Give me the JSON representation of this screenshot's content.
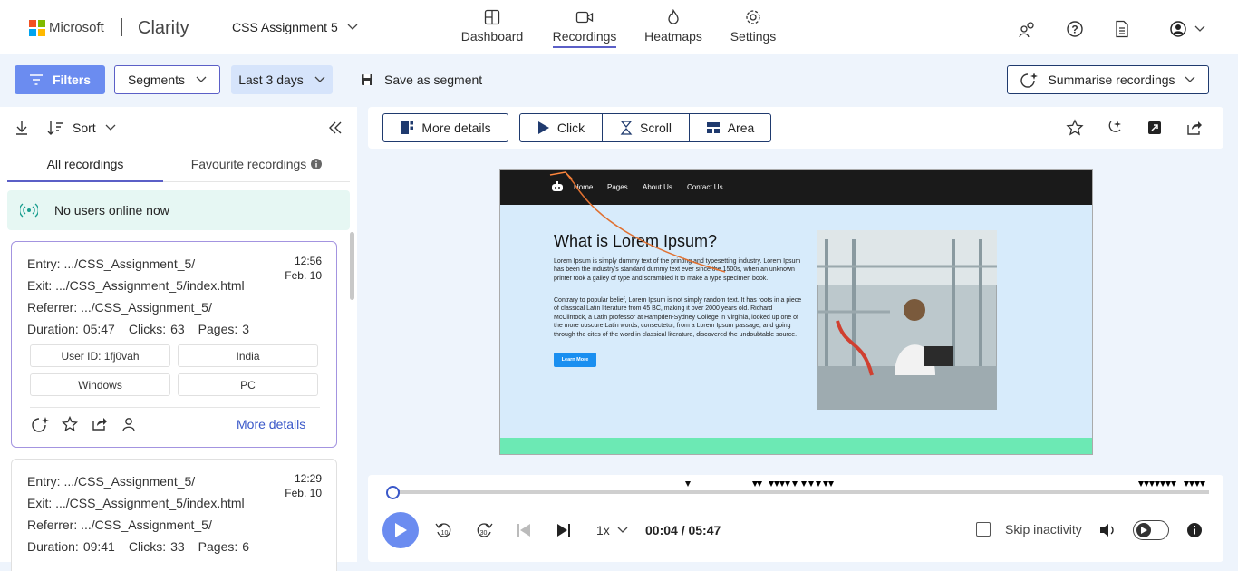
{
  "app": {
    "brand": "Microsoft",
    "product": "Clarity",
    "project": "CSS Assignment 5"
  },
  "nav": [
    {
      "label": "Dashboard",
      "icon": "dashboard-icon"
    },
    {
      "label": "Recordings",
      "icon": "video-icon",
      "active": true
    },
    {
      "label": "Heatmaps",
      "icon": "flame-icon"
    },
    {
      "label": "Settings",
      "icon": "gear-icon"
    }
  ],
  "toolbar": {
    "filters_label": "Filters",
    "segments_label": "Segments",
    "daterange_label": "Last 3 days",
    "save_segment_label": "Save as segment",
    "summarise_label": "Summarise recordings"
  },
  "left": {
    "sort_label": "Sort",
    "tabs": [
      "All recordings",
      "Favourite recordings"
    ],
    "online_text": "No users online now",
    "recordings": [
      {
        "entry": "Entry: .../CSS_Assignment_5/",
        "exit": "Exit: .../CSS_Assignment_5/index.html",
        "referrer": "Referrer: .../CSS_Assignment_5/",
        "duration_label": "Duration:",
        "duration": "05:47",
        "clicks_label": "Clicks:",
        "clicks": "63",
        "pages_label": "Pages:",
        "pages": "3",
        "time": "12:56",
        "date": "Feb. 10",
        "chips": [
          "User ID: 1fj0vah",
          "India",
          "Windows",
          "PC"
        ],
        "more_details": "More details"
      },
      {
        "entry": "Entry: .../CSS_Assignment_5/",
        "exit": "Exit: .../CSS_Assignment_5/index.html",
        "referrer": "Referrer: .../CSS_Assignment_5/",
        "duration_label": "Duration:",
        "duration": "09:41",
        "clicks_label": "Clicks:",
        "clicks": "33",
        "pages_label": "Pages:",
        "pages": "6",
        "time": "12:29",
        "date": "Feb. 10"
      }
    ]
  },
  "player": {
    "more_details_label": "More details",
    "click_label": "Click",
    "scroll_label": "Scroll",
    "area_label": "Area",
    "speed": "1x",
    "time_current": "00:04",
    "time_sep": " / ",
    "time_total": "05:47",
    "skip_label": "Skip inactivity",
    "progress": 0.012
  },
  "site": {
    "nav": [
      "Home",
      "Pages",
      "About Us",
      "Contact Us"
    ],
    "heading": "What is Lorem Ipsum?",
    "para1": "Lorem Ipsum is simply dummy text of the printing and typesetting industry. Lorem Ipsum has been the industry's standard dummy text ever since the 1500s, when an unknown printer took a galley of type and scrambled it to make a type specimen book.",
    "para2": "Contrary to popular belief, Lorem Ipsum is not simply random text. It has roots in a piece of classical Latin literature from 45 BC, making it over 2000 years old. Richard McClintock, a Latin professor at Hampden-Sydney College in Virginia, looked up one of the more obscure Latin words, consectetur, from a Lorem Ipsum passage, and going through the cites of the word in classical literature, discovered the undoubtable source.",
    "button": "Learn More"
  },
  "colors": {
    "accent": "#5b5fc7",
    "navy": "#1f3a6e",
    "play": "#6b8cf0",
    "online_bg": "#e6f7f3",
    "site_green": "#6ce9b4"
  }
}
